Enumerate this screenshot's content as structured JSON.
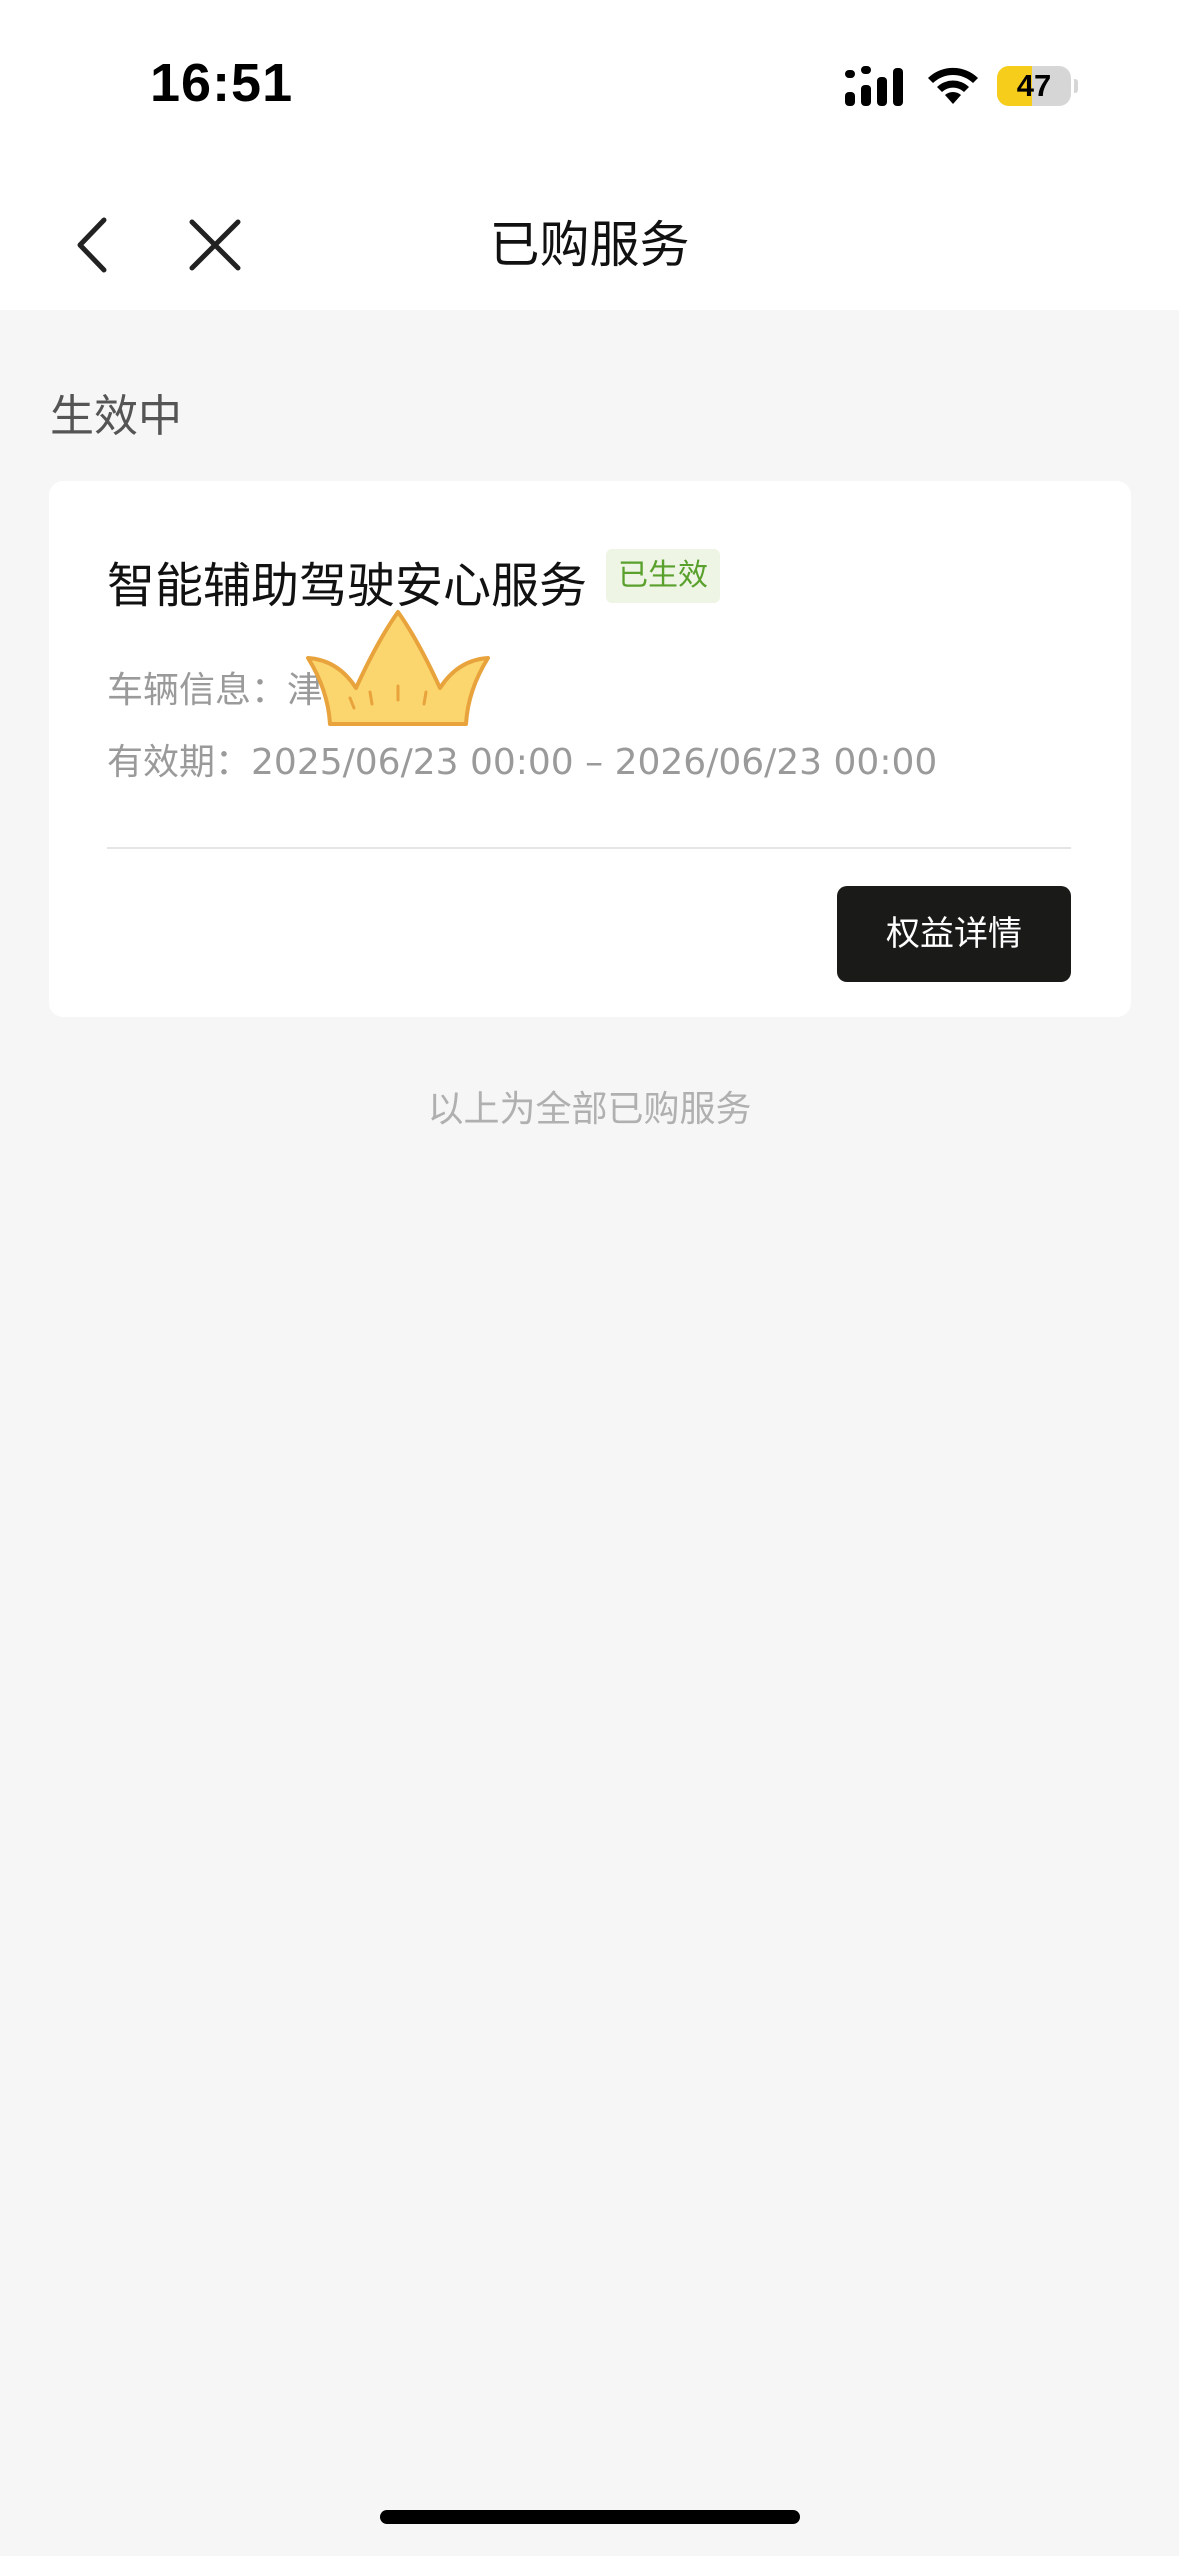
{
  "status_bar": {
    "time": "16:51",
    "battery_percent": "47",
    "battery_level": 0.47,
    "icons": [
      "signal-icon",
      "wifi-icon",
      "battery-icon"
    ]
  },
  "nav": {
    "title": "已购服务",
    "back_icon": "chevron-left-icon",
    "close_icon": "close-icon"
  },
  "section": {
    "title": "生效中"
  },
  "service_card": {
    "name": "智能辅助驾驶安心服务",
    "status": "已生效",
    "vehicle_label": "车辆信息：",
    "vehicle_value": "津",
    "validity_label": "有效期：",
    "validity_value": "2025/06/23 00:00 – 2026/06/23 00:00",
    "button_label": "权益详情"
  },
  "overlay": {
    "sticker_icon": "crown-sticker-icon"
  },
  "footer": {
    "note": "以上为全部已购服务"
  },
  "colors": {
    "badge_text": "#5aa02c",
    "badge_bg": "#eef5e4",
    "button_bg": "#1a1a18",
    "battery_fill": "#f7cd1c",
    "page_bg": "#f6f6f6"
  }
}
